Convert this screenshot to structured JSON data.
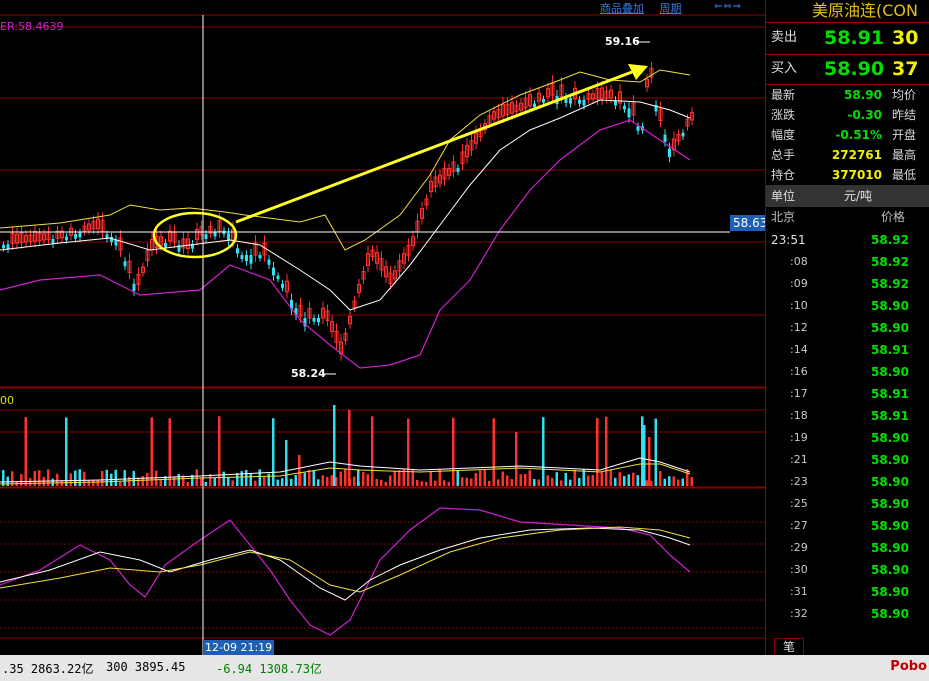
{
  "toolbar": {
    "overlay_label": "商品叠加",
    "period_label": "周期",
    "nav_icons": "⇐⇔⇒"
  },
  "main_chart": {
    "ma_label": "ER:58.4639",
    "high_label": "59.16",
    "low_label": "58.24",
    "current_price_tag": "58.63",
    "crosshair_time": "12-09 21:19",
    "volume_label": "00"
  },
  "colors": {
    "bull": "#ff3030",
    "bear": "#33e0f0",
    "upper_band": "#f0e040",
    "mid_band": "#ffffff",
    "lower_band": "#d020d0",
    "arrow": "#ffff20",
    "grid": "#8b0000",
    "price_green": "#00e000"
  },
  "quote": {
    "title": "美原油连(CON",
    "sell": {
      "label": "卖出",
      "price": "58.91",
      "volume": "30"
    },
    "buy": {
      "label": "买入",
      "price": "58.90",
      "volume": "37"
    },
    "fields": [
      {
        "label": "最新",
        "value": "58.90",
        "label2": "均价",
        "color": "#00e000"
      },
      {
        "label": "涨跌",
        "value": "-0.30",
        "label2": "昨结",
        "color": "#00e000"
      },
      {
        "label": "幅度",
        "value": "-0.51%",
        "label2": "开盘",
        "color": "#00e000"
      },
      {
        "label": "总手",
        "value": "272761",
        "label2": "最高",
        "color": "#f0f000"
      },
      {
        "label": "持仓",
        "value": "377010",
        "label2": "最低",
        "color": "#f0f000"
      }
    ],
    "unit_label": "单位",
    "unit_value": "元/吨",
    "city_label": "北京",
    "price_header": "价格"
  },
  "ticks": [
    {
      "time": "23:51",
      "price": "58.92"
    },
    {
      "time": ":08",
      "price": "58.92"
    },
    {
      "time": ":09",
      "price": "58.92"
    },
    {
      "time": ":10",
      "price": "58.90"
    },
    {
      "time": ":12",
      "price": "58.90"
    },
    {
      "time": ":14",
      "price": "58.91"
    },
    {
      "time": ":16",
      "price": "58.90"
    },
    {
      "time": ":17",
      "price": "58.91"
    },
    {
      "time": ":18",
      "price": "58.91"
    },
    {
      "time": ":19",
      "price": "58.90"
    },
    {
      "time": ":21",
      "price": "58.90"
    },
    {
      "time": ":23",
      "price": "58.90"
    },
    {
      "time": ":25",
      "price": "58.90"
    },
    {
      "time": ":27",
      "price": "58.90"
    },
    {
      "time": ":29",
      "price": "58.90"
    },
    {
      "time": ":30",
      "price": "58.90"
    },
    {
      "time": ":31",
      "price": "58.90"
    },
    {
      "time": ":32",
      "price": "58.90"
    }
  ],
  "tick_tab_label": "笔",
  "status_bar": {
    "seg1": ".35  2863.22亿",
    "seg2": "300  3895.45",
    "seg3": "-6.94  1308.73亿",
    "logo": "Pobo"
  },
  "chart_data": {
    "type": "candlestick",
    "high": 59.16,
    "low": 58.24,
    "current": 58.63,
    "price_axis_reference": 58.63
  }
}
